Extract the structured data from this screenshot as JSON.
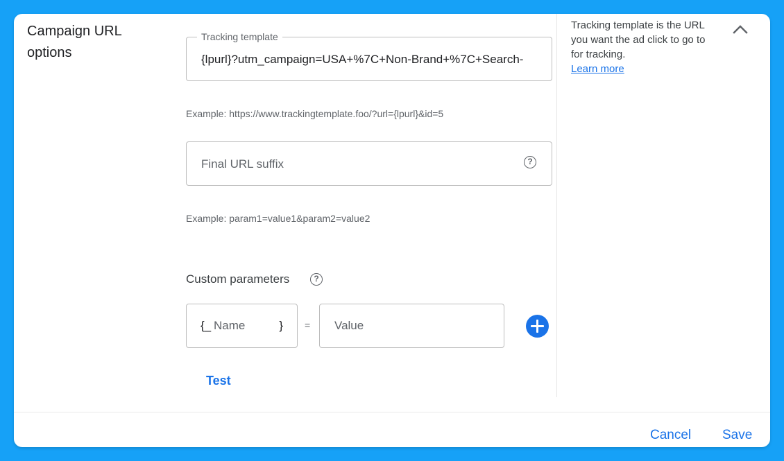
{
  "section": {
    "title": "Campaign URL options"
  },
  "tracking_template": {
    "label": "Tracking template",
    "value": "{lpurl}?utm_campaign=USA+%7C+Non-Brand+%7C+Search-",
    "example": "Example: https://www.trackingtemplate.foo/?url={lpurl}&id=5"
  },
  "final_url_suffix": {
    "placeholder": "Final URL suffix",
    "value": "",
    "help_icon": "help-circle-icon",
    "example": "Example: param1=value1&param2=value2"
  },
  "custom_parameters": {
    "label": "Custom parameters",
    "help_icon": "help-circle-icon",
    "name_prefix": "{_",
    "name_placeholder": "Name",
    "name_suffix": "}",
    "equals": "=",
    "value_placeholder": "Value",
    "add_icon": "add-circle-icon"
  },
  "test_button": "Test",
  "info": {
    "text": "Tracking template is the URL you want the ad click to go to for tracking.",
    "link": "Learn more",
    "collapse_icon": "chevron-up-icon"
  },
  "footer": {
    "cancel": "Cancel",
    "save": "Save"
  },
  "colors": {
    "background": "#16a1f7",
    "accent": "#1a73e8",
    "text_primary": "#202124",
    "text_secondary": "#5f6368"
  }
}
